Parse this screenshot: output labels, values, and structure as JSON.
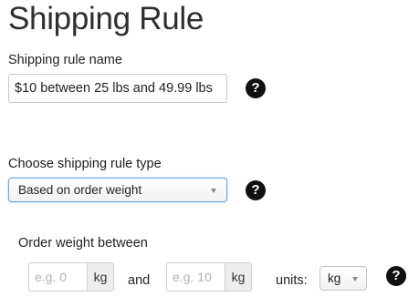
{
  "page": {
    "title": "Shipping Rule"
  },
  "rule_name": {
    "label": "Shipping rule name",
    "value": "$10 between 25 lbs and 49.99 lbs"
  },
  "rule_type": {
    "label": "Choose shipping rule type",
    "selected": "Based on order weight"
  },
  "weight_range": {
    "label": "Order weight between",
    "min_placeholder": "e.g. 0",
    "min_unit": "kg",
    "connector": "and",
    "max_placeholder": "e.g. 10",
    "max_unit": "kg",
    "units_label": "units:",
    "units_selected": "kg"
  },
  "icons": {
    "help": "question-circle-icon",
    "dropdown": "caret-down-icon"
  },
  "colors": {
    "select_focus_border": "#6ea4dc",
    "addon_background": "#eeeeee",
    "help_icon": "#111111"
  }
}
